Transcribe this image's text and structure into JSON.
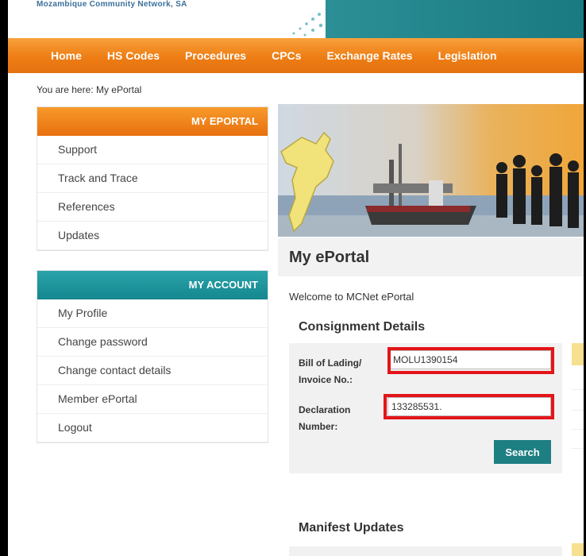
{
  "brand": "Mozambique Community Network, SA",
  "nav": [
    "Home",
    "HS Codes",
    "Procedures",
    "CPCs",
    "Exchange Rates",
    "Legislation"
  ],
  "breadcrumb": "You are here: My ePortal",
  "my_eportal": {
    "title": "MY EPORTAL",
    "items": [
      "Support",
      "Track and Trace",
      "References",
      "Updates"
    ]
  },
  "my_account": {
    "title": "MY ACCOUNT",
    "items": [
      "My Profile",
      "Change password",
      "Change contact details",
      "Member ePortal",
      "Logout"
    ]
  },
  "main": {
    "title": "My ePortal",
    "welcome": "Welcome to MCNet ePortal",
    "consignment_title": "Consignment Details",
    "bol_label": "Bill of Lading/ Invoice No.:",
    "bol_value": "MOLU1390154",
    "declaration_label": "Declaration Number:",
    "declaration_value": "133285531.",
    "search_label": "Search",
    "manifest_title": "Manifest Updates"
  },
  "colors": {
    "nav_orange": "#ee7d14",
    "teal": "#1e7f83",
    "highlight_red": "#e3151a"
  }
}
